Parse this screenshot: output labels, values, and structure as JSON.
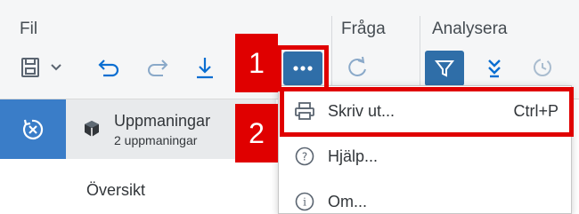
{
  "toolbar": {
    "groups": {
      "file": "Fil",
      "query": "Fråga",
      "analyze": "Analysera"
    },
    "buttons": [
      "save",
      "undo",
      "redo",
      "export",
      "more",
      "refresh",
      "filter",
      "hierarchy",
      "history"
    ]
  },
  "sidebar": {
    "prompts_title": "Uppmaningar",
    "prompts_count": "2 uppmaningar",
    "overview": "Översikt"
  },
  "menu": {
    "items": [
      {
        "label": "Skriv ut...",
        "shortcut": "Ctrl+P",
        "icon": "printer-icon"
      },
      {
        "label": "Hjälp...",
        "shortcut": "",
        "icon": "help-icon"
      },
      {
        "label": "Om...",
        "shortcut": "",
        "icon": "info-icon"
      }
    ]
  },
  "annotations": {
    "step1": "1",
    "step2": "2"
  },
  "colors": {
    "accent": "#0a6ed1",
    "highlight": "#e00000",
    "collapse_bg": "#3a7dc8",
    "filter_bg": "#2f6ea8"
  }
}
